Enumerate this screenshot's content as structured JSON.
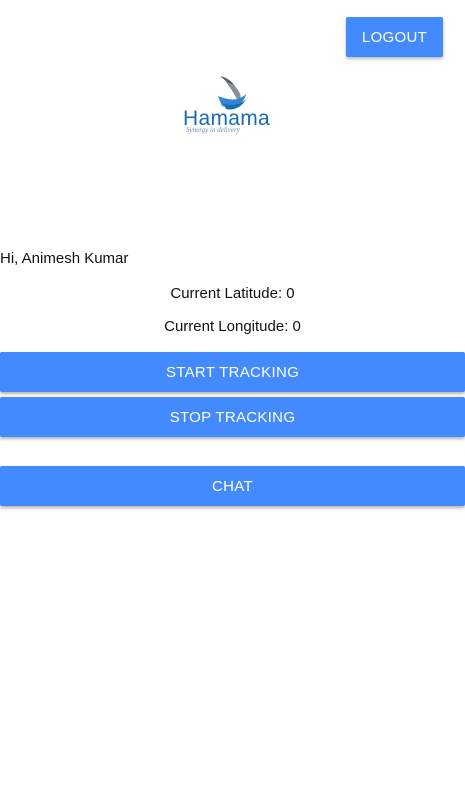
{
  "header": {
    "logout_label": "LOGOUT"
  },
  "logo": {
    "wordmark": "Hamama",
    "tagline": "Synergy in delivery",
    "icon": "bird-logo-icon"
  },
  "user": {
    "greeting": "Hi, Animesh Kumar"
  },
  "location": {
    "latitude_text": "Current Latitude: 0",
    "longitude_text": "Current Longitude: 0"
  },
  "actions": {
    "start_label": "START TRACKING",
    "stop_label": "STOP TRACKING",
    "chat_label": "CHAT"
  },
  "colors": {
    "accent": "#448aff",
    "logo_blue": "#1b6bb3",
    "text": "#111111",
    "background": "#ffffff"
  }
}
